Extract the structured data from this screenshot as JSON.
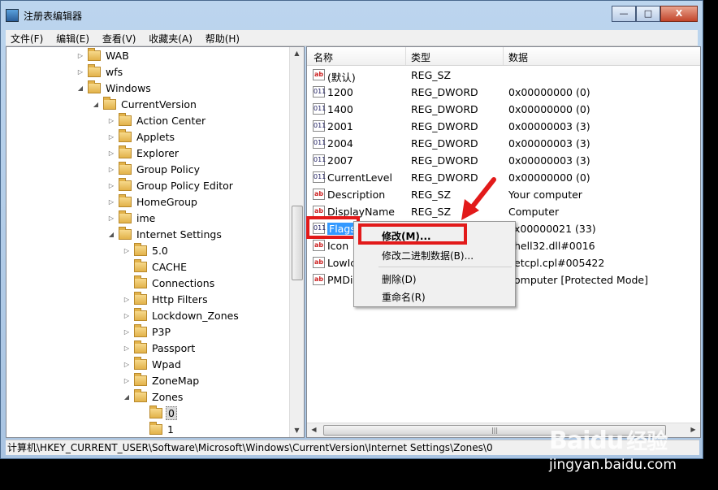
{
  "window": {
    "title": "注册表编辑器",
    "min": "—",
    "max": "□",
    "close": "X"
  },
  "menu": [
    "文件(F)",
    "编辑(E)",
    "查看(V)",
    "收藏夹(A)",
    "帮助(H)"
  ],
  "tree": [
    {
      "label": "WAB",
      "level": 0,
      "exp": "▷"
    },
    {
      "label": "wfs",
      "level": 0,
      "exp": "▷"
    },
    {
      "label": "Windows",
      "level": 0,
      "exp": "◢"
    },
    {
      "label": "CurrentVersion",
      "level": 1,
      "exp": "◢"
    },
    {
      "label": "Action Center",
      "level": 2,
      "exp": "▷"
    },
    {
      "label": "Applets",
      "level": 2,
      "exp": "▷"
    },
    {
      "label": "Explorer",
      "level": 2,
      "exp": "▷"
    },
    {
      "label": "Group Policy",
      "level": 2,
      "exp": "▷"
    },
    {
      "label": "Group Policy Editor",
      "level": 2,
      "exp": "▷"
    },
    {
      "label": "HomeGroup",
      "level": 2,
      "exp": "▷"
    },
    {
      "label": "ime",
      "level": 2,
      "exp": "▷"
    },
    {
      "label": "Internet Settings",
      "level": 2,
      "exp": "◢"
    },
    {
      "label": "5.0",
      "level": 3,
      "exp": "▷"
    },
    {
      "label": "CACHE",
      "level": 3,
      "exp": ""
    },
    {
      "label": "Connections",
      "level": 3,
      "exp": ""
    },
    {
      "label": "Http Filters",
      "level": 3,
      "exp": "▷"
    },
    {
      "label": "Lockdown_Zones",
      "level": 3,
      "exp": "▷"
    },
    {
      "label": "P3P",
      "level": 3,
      "exp": "▷"
    },
    {
      "label": "Passport",
      "level": 3,
      "exp": "▷"
    },
    {
      "label": "Wpad",
      "level": 3,
      "exp": "▷"
    },
    {
      "label": "ZoneMap",
      "level": 3,
      "exp": "▷"
    },
    {
      "label": "Zones",
      "level": 3,
      "exp": "◢"
    },
    {
      "label": "0",
      "level": 4,
      "exp": "",
      "selected": true
    },
    {
      "label": "1",
      "level": 4,
      "exp": ""
    }
  ],
  "columns": {
    "name": "名称",
    "type": "类型",
    "data": "数据"
  },
  "values": [
    {
      "name": "(默认)",
      "type": "REG_SZ",
      "data": "",
      "icon": "ab"
    },
    {
      "name": "1200",
      "type": "REG_DWORD",
      "data": "0x00000000 (0)",
      "icon": "bin"
    },
    {
      "name": "1400",
      "type": "REG_DWORD",
      "data": "0x00000000 (0)",
      "icon": "bin"
    },
    {
      "name": "2001",
      "type": "REG_DWORD",
      "data": "0x00000003 (3)",
      "icon": "bin"
    },
    {
      "name": "2004",
      "type": "REG_DWORD",
      "data": "0x00000003 (3)",
      "icon": "bin"
    },
    {
      "name": "2007",
      "type": "REG_DWORD",
      "data": "0x00000003 (3)",
      "icon": "bin"
    },
    {
      "name": "CurrentLevel",
      "type": "REG_DWORD",
      "data": "0x00000000 (0)",
      "icon": "bin"
    },
    {
      "name": "Description",
      "type": "REG_SZ",
      "data": "Your computer",
      "icon": "ab"
    },
    {
      "name": "DisplayName",
      "type": "REG_SZ",
      "data": "Computer",
      "icon": "ab"
    },
    {
      "name": "Flags",
      "type": "",
      "data": "x00000021 (33)",
      "icon": "bin",
      "selected": true
    },
    {
      "name": "Icon",
      "type": "",
      "data": "hell32.dll#0016",
      "icon": "ab"
    },
    {
      "name": "LowIc",
      "type": "",
      "data": "etcpl.cpl#005422",
      "icon": "ab"
    },
    {
      "name": "PMDis",
      "type": "",
      "data": "omputer [Protected Mode]",
      "icon": "ab"
    }
  ],
  "context_menu": {
    "modify": "修改(M)...",
    "modify_binary": "修改二进制数据(B)...",
    "delete": "删除(D)",
    "rename": "重命名(R)"
  },
  "status": "计算机\\HKEY_CURRENT_USER\\Software\\Microsoft\\Windows\\CurrentVersion\\Internet Settings\\Zones\\0",
  "watermark": {
    "brand": "Baidu",
    "subtitle": "经验",
    "url": "jingyan.baidu.com"
  },
  "colors": {
    "highlight": "#e21a1a",
    "selection": "#3399ff"
  }
}
